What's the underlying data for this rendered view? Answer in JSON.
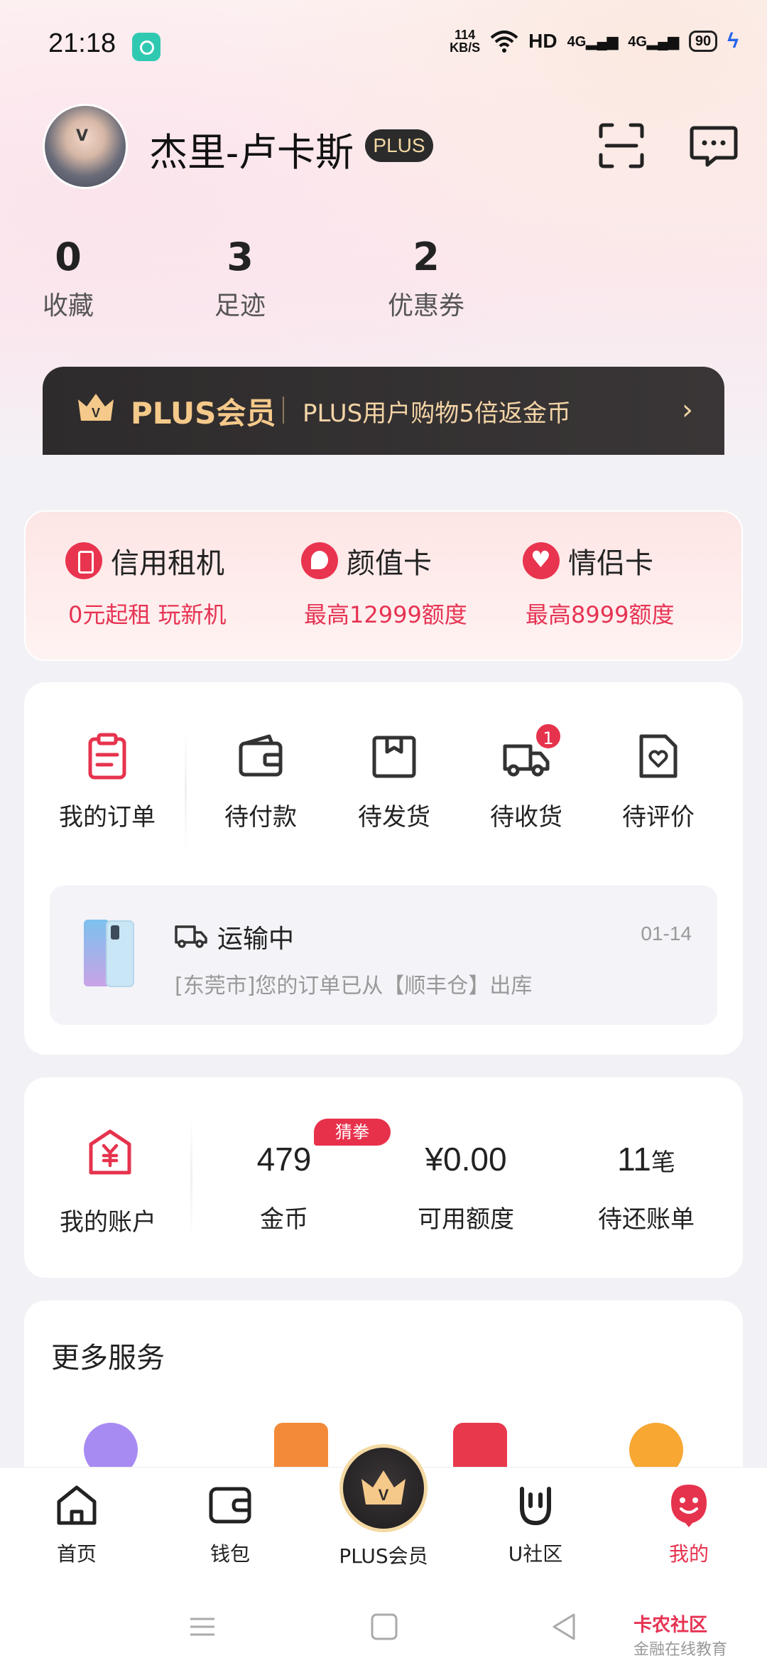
{
  "status_bar": {
    "time": "21:18",
    "net_speed_value": "114",
    "net_speed_unit": "KB/S",
    "hd_label": "HD",
    "signal1": "4G",
    "signal2": "4G",
    "battery": "90"
  },
  "profile": {
    "username": "杰里-卢卡斯",
    "badge": "PLUS"
  },
  "stats": [
    {
      "value": "0",
      "label": "收藏"
    },
    {
      "value": "3",
      "label": "足迹"
    },
    {
      "value": "2",
      "label": "优惠券"
    }
  ],
  "plus_banner": {
    "title": "PLUS会员",
    "subtitle": "PLUS用户购物5倍返金币",
    "arrow": "›"
  },
  "credit": [
    {
      "title": "信用租机",
      "subtitle": "0元起租 玩新机",
      "icon": "phone-icon"
    },
    {
      "title": "颜值卡",
      "subtitle": "最高12999额度",
      "icon": "face-icon"
    },
    {
      "title": "情侣卡",
      "subtitle": "最高8999额度",
      "icon": "heart-icon"
    }
  ],
  "orders": {
    "main_label": "我的订单",
    "items": [
      {
        "label": "待付款",
        "icon": "wallet-icon"
      },
      {
        "label": "待发货",
        "icon": "box-icon"
      },
      {
        "label": "待收货",
        "icon": "truck-icon",
        "badge": "1"
      },
      {
        "label": "待评价",
        "icon": "review-icon"
      }
    ],
    "shipment": {
      "status": "运输中",
      "date": "01-14",
      "message": "[东莞市]您的订单已从【顺丰仓】出库"
    }
  },
  "account": {
    "label": "我的账户",
    "guess_tag": "猜拳",
    "items": [
      {
        "value": "479",
        "suffix": "",
        "label": "金币"
      },
      {
        "value": "¥0.00",
        "suffix": "",
        "label": "可用额度"
      },
      {
        "value": "11",
        "suffix": "笔",
        "label": "待还账单"
      }
    ]
  },
  "more_services": {
    "title": "更多服务",
    "icons": [
      "alarm-icon",
      "calendar-icon",
      "new-year-icon",
      "coin-icon"
    ]
  },
  "tabbar": {
    "items": [
      {
        "label": "首页",
        "icon": "home-icon"
      },
      {
        "label": "钱包",
        "icon": "wallet-icon"
      },
      {
        "label": "PLUS会员",
        "icon": "plus-crown-icon"
      },
      {
        "label": "U社区",
        "icon": "community-icon"
      },
      {
        "label": "我的",
        "icon": "profile-icon",
        "active": true
      }
    ]
  },
  "watermark": {
    "brand": "卡农社区",
    "sub": "金融在线教育"
  },
  "colors": {
    "accent": "#e6334d",
    "gold": "#f5c98a",
    "dark": "#2e2b2c"
  }
}
